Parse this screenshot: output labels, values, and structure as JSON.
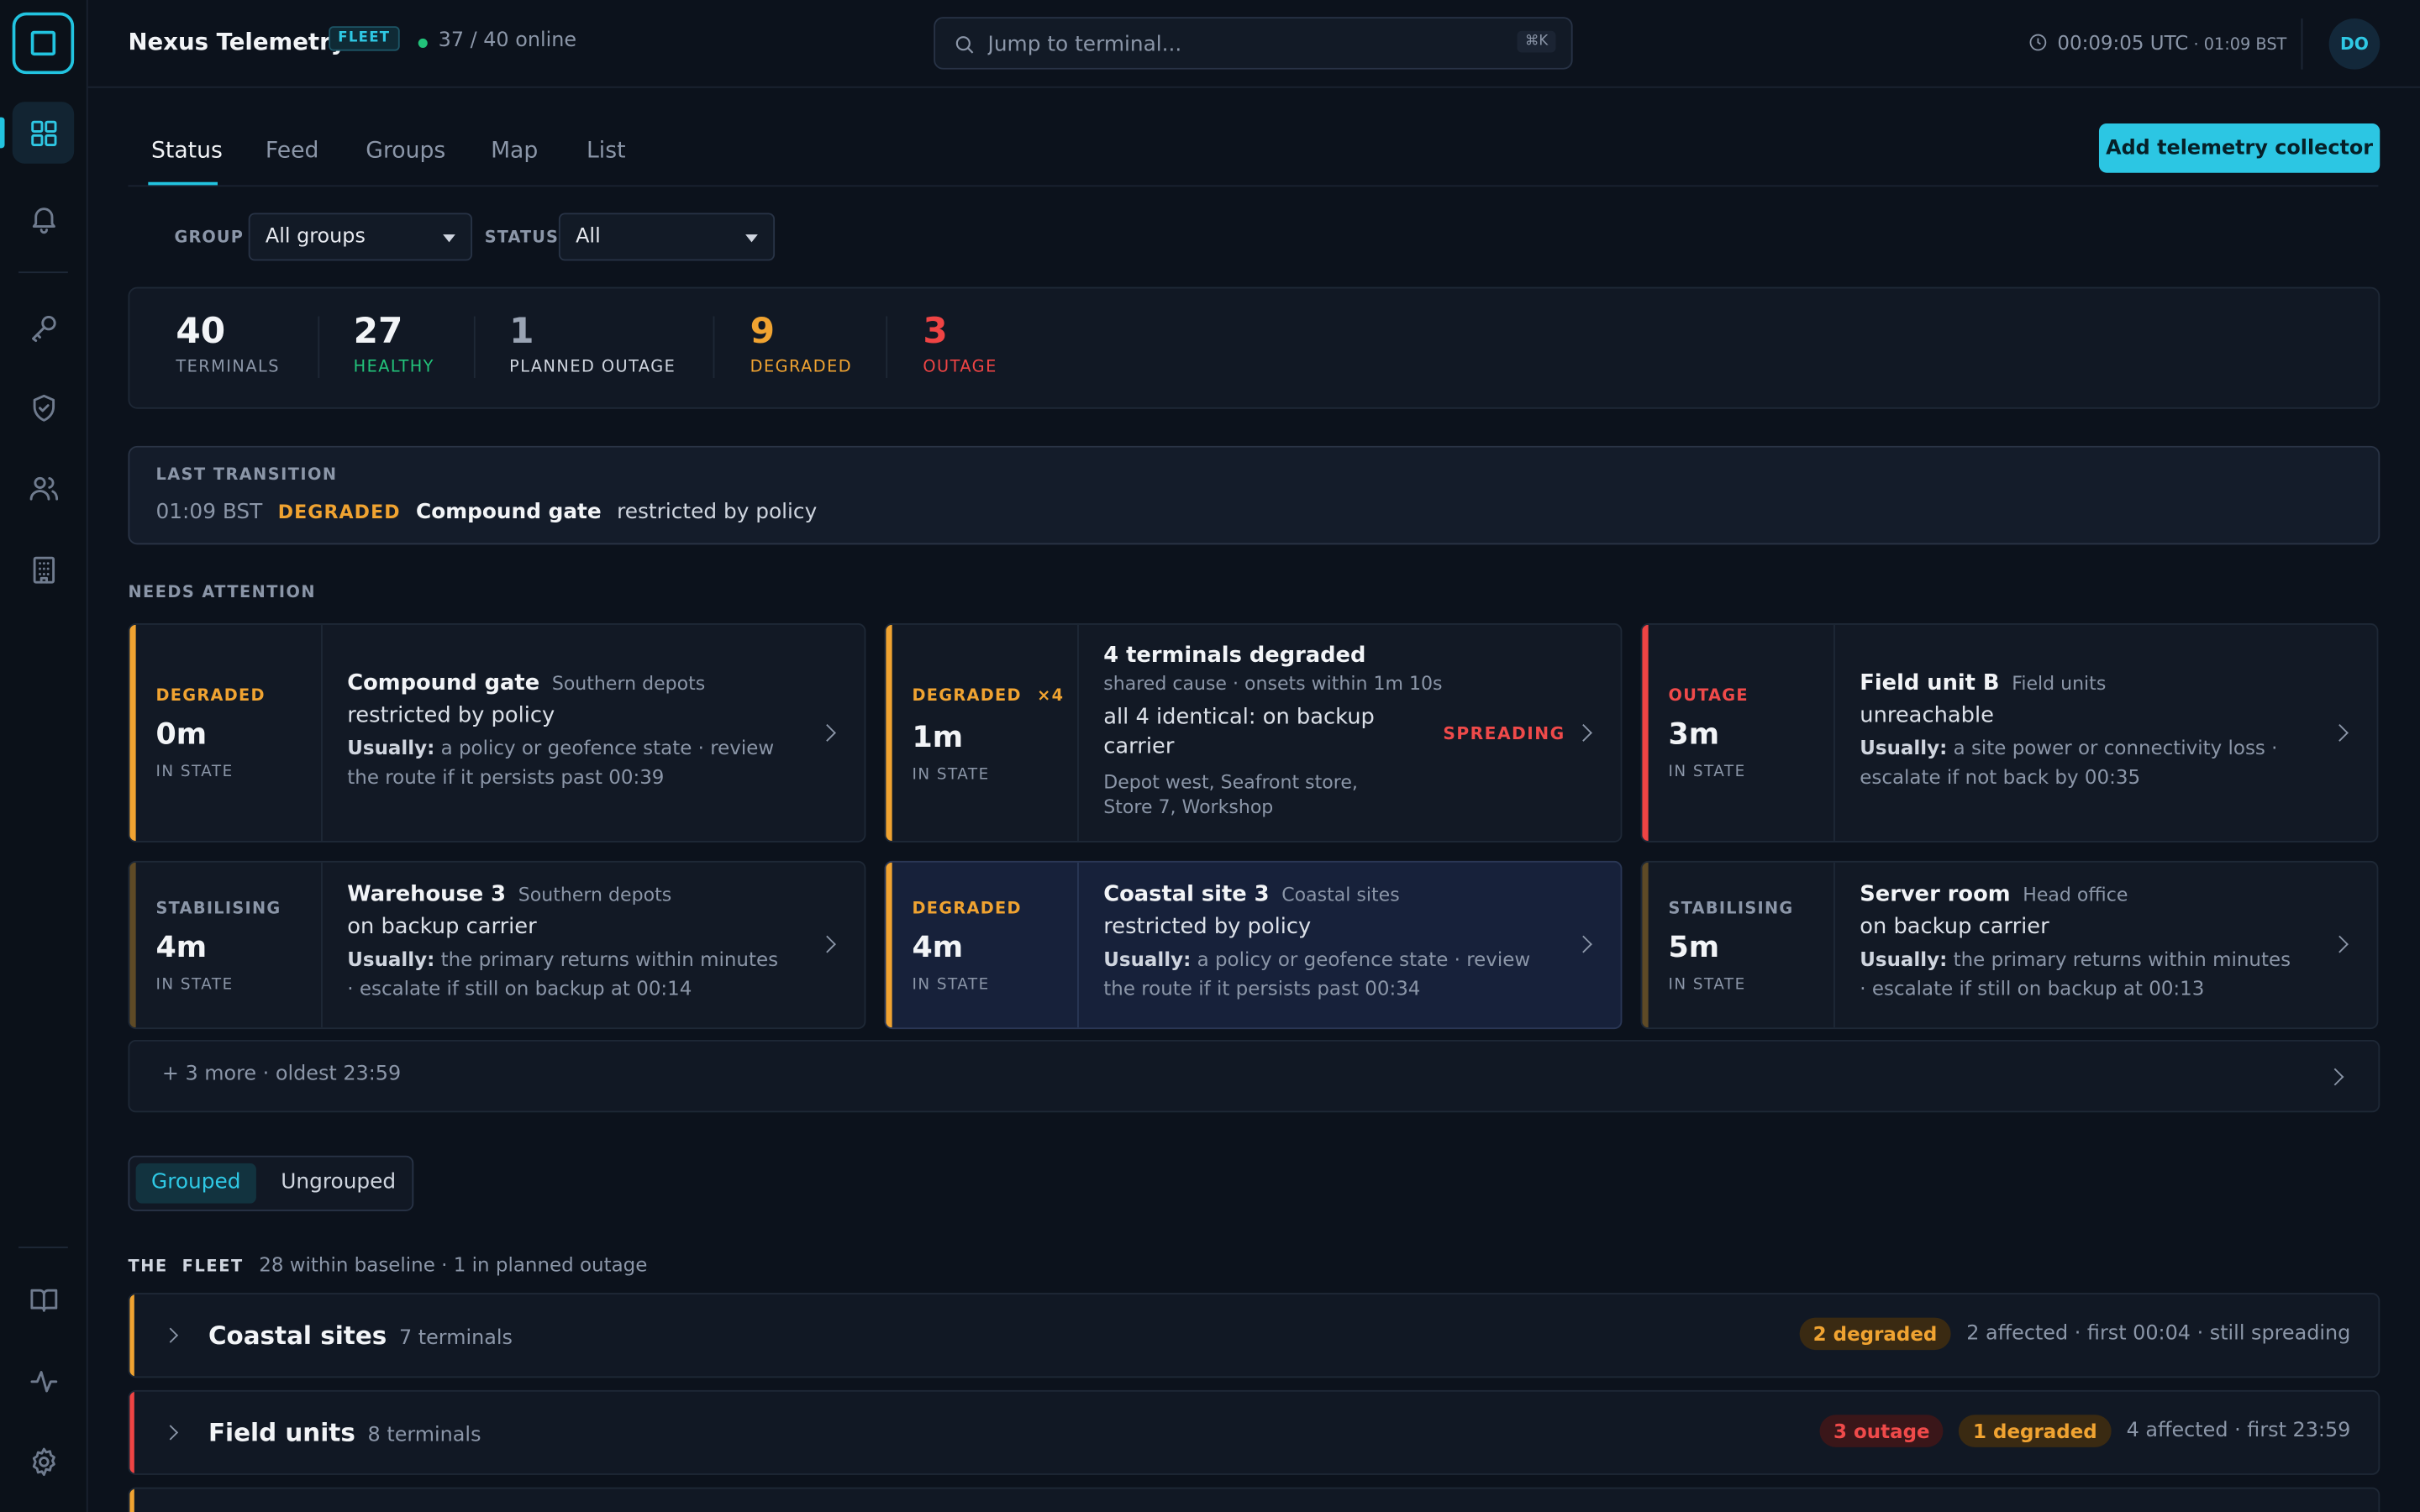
{
  "colors": {
    "accent": "#22c4e0",
    "degraded": "#f0a331",
    "outage": "#ef4444",
    "healthy": "#22c37a",
    "stabilising": "#8a6a2e"
  },
  "sidebar": {
    "items": [
      {
        "icon": "grid-icon",
        "label": "Dashboard",
        "active": true
      },
      {
        "icon": "bell-icon",
        "label": "Alerts"
      },
      {
        "icon": "key-icon",
        "label": "Keys"
      },
      {
        "icon": "shield-icon",
        "label": "Security"
      },
      {
        "icon": "users-icon",
        "label": "Users"
      },
      {
        "icon": "building-icon",
        "label": "Sites"
      },
      {
        "icon": "book-icon",
        "label": "Docs"
      },
      {
        "icon": "activity-icon",
        "label": "Activity"
      },
      {
        "icon": "gear-icon",
        "label": "Settings"
      }
    ]
  },
  "header": {
    "title": "Nexus Telemetry",
    "badge": "FLEET",
    "online": "37 / 40 online",
    "search_placeholder": "Jump to terminal...",
    "search_shortcut": "⌘K",
    "time_main": "00:09:05 UTC",
    "time_sep": " · ",
    "time_local": "01:09 BST",
    "avatar": "DO"
  },
  "tabs": [
    "Status",
    "Feed",
    "Groups",
    "Map",
    "List"
  ],
  "add_button": "Add telemetry collector",
  "filters": {
    "group_label": "GROUP",
    "group_value": "All groups",
    "status_label": "STATUS",
    "status_value": "All"
  },
  "stats": [
    {
      "value": "40",
      "label": "TERMINALS",
      "tone": "neutral"
    },
    {
      "value": "27",
      "label": "HEALTHY",
      "tone": "healthy"
    },
    {
      "value": "1",
      "label": "PLANNED OUTAGE",
      "tone": "planned"
    },
    {
      "value": "9",
      "label": "DEGRADED",
      "tone": "degraded"
    },
    {
      "value": "3",
      "label": "OUTAGE",
      "tone": "outage"
    }
  ],
  "last_transition": {
    "label": "LAST TRANSITION",
    "time": "01:09 BST",
    "state": "DEGRADED",
    "name": "Compound gate",
    "desc": "restricted by policy"
  },
  "needs_attention": {
    "label": "NEEDS ATTENTION",
    "cards": [
      {
        "state": "DEGRADED",
        "mult": "",
        "duration": "0m",
        "in_state": "IN STATE",
        "title": "Compound gate",
        "group": "Southern depots",
        "reason": "restricted by policy",
        "usually_label": "Usually:",
        "usually": " a policy or geofence state · review the route if it persists past 00:39"
      },
      {
        "state": "DEGRADED",
        "mult": "×4",
        "duration": "1m",
        "in_state": "IN STATE",
        "title": "4 terminals degraded",
        "sub": "shared cause · onsets within 1m 10s",
        "reason": "all 4 identical: on backup carrier",
        "list": "Depot west, Seafront store, Store 7, Workshop",
        "tag": "SPREADING"
      },
      {
        "state": "OUTAGE",
        "mult": "",
        "duration": "3m",
        "in_state": "IN STATE",
        "title": "Field unit B",
        "group": "Field units",
        "reason": "unreachable",
        "usually_label": "Usually:",
        "usually": " a site power or connectivity loss · escalate if not back by 00:35"
      },
      {
        "state": "STABILISING",
        "mult": "",
        "duration": "4m",
        "in_state": "IN STATE",
        "title": "Warehouse 3",
        "group": "Southern depots",
        "reason": "on backup carrier",
        "usually_label": "Usually:",
        "usually": " the primary returns within minutes · escalate if still on backup at 00:14"
      },
      {
        "state": "DEGRADED",
        "mult": "",
        "duration": "4m",
        "in_state": "IN STATE",
        "title": "Coastal site 3",
        "group": "Coastal sites",
        "reason": "restricted by policy",
        "usually_label": "Usually:",
        "usually": " a policy or geofence state · review the route if it persists past 00:34"
      },
      {
        "state": "STABILISING",
        "mult": "",
        "duration": "5m",
        "in_state": "IN STATE",
        "title": "Server room",
        "group": "Head office",
        "reason": "on backup carrier",
        "usually_label": "Usually:",
        "usually": " the primary returns within minutes · escalate if still on backup at 00:13"
      }
    ],
    "more": "+ 3 more · oldest 23:59"
  },
  "view_toggle": {
    "grouped": "Grouped",
    "ungrouped": "Ungrouped"
  },
  "fleet": {
    "title": "THE  FLEET",
    "summary": "28 within baseline · 1 in planned outage",
    "groups": [
      {
        "name": "Coastal sites",
        "count": "7 terminals",
        "pills": [
          {
            "text": "2 degraded",
            "kind": "degraded"
          }
        ],
        "affected": "2 affected · first 00:04 · still spreading"
      },
      {
        "name": "Field units",
        "count": "8 terminals",
        "pills": [
          {
            "text": "3 outage",
            "kind": "outage"
          },
          {
            "text": "1 degraded",
            "kind": "degraded"
          }
        ],
        "affected": "4 affected · first 23:59"
      }
    ]
  }
}
